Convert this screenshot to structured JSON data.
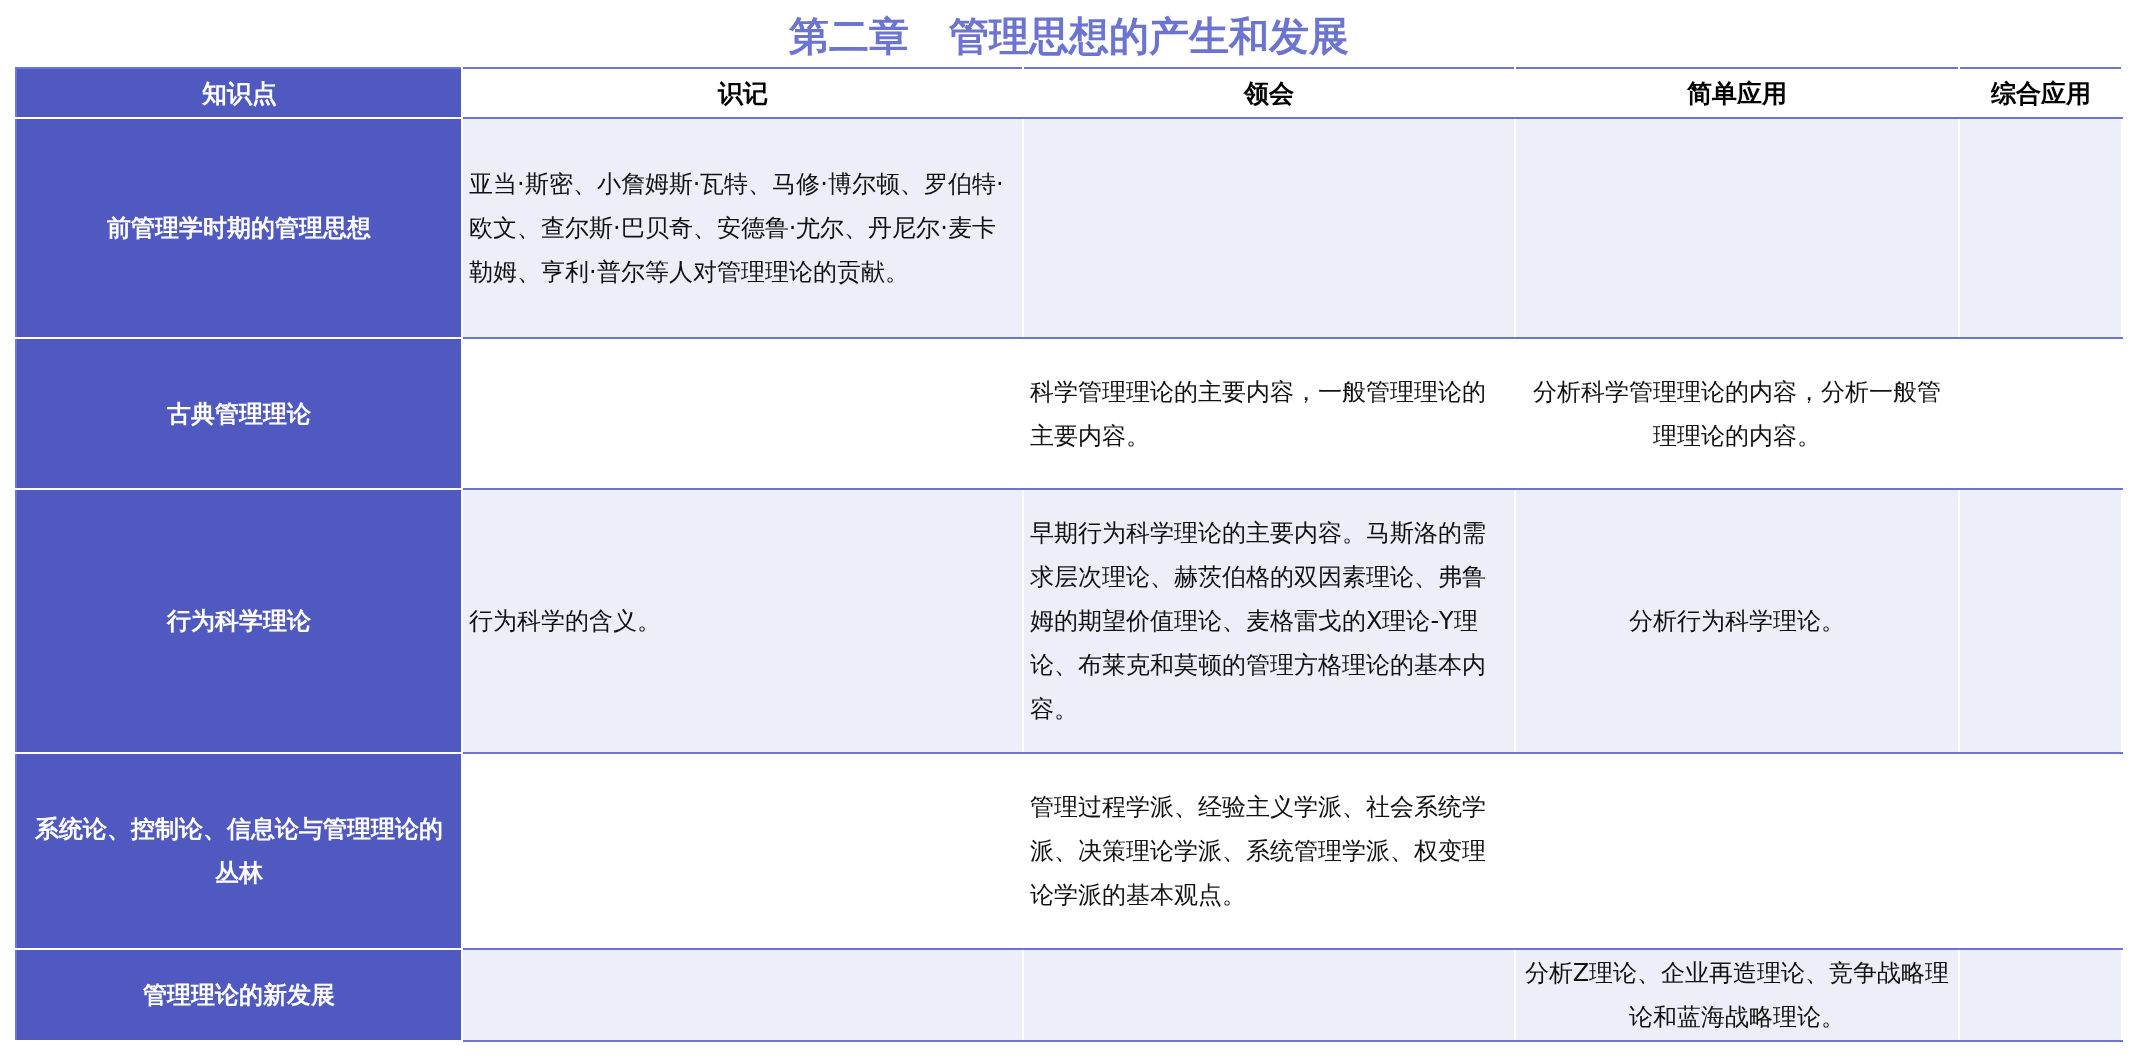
{
  "title": "第二章　管理思想的产生和发展",
  "table": {
    "columns": [
      "知识点",
      "识记",
      "领会",
      "简单应用",
      "综合应用"
    ],
    "rows": [
      {
        "cells": [
          "前管理学时期的管理思想",
          "亚当·斯密、小詹姆斯·瓦特、马修·博尔顿、罗伯特·欧文、查尔斯·巴贝奇、安德鲁·尤尔、丹尼尔·麦卡勒姆、亨利·普尔等人对管理理论的贡献。",
          "",
          "",
          ""
        ]
      },
      {
        "cells": [
          "古典管理理论",
          "",
          "科学管理理论的主要内容，一般管理理论的主要内容。",
          "分析科学管理理论的内容，分析一般管理理论的内容。",
          ""
        ]
      },
      {
        "cells": [
          "行为科学理论",
          "行为科学的含义。",
          "早期行为科学理论的主要内容。马斯洛的需求层次理论、赫茨伯格的双因素理论、弗鲁姆的期望价值理论、麦格雷戈的X理论-Y理论、布莱克和莫顿的管理方格理论的基本内容。",
          "分析行为科学理论。",
          ""
        ]
      },
      {
        "cells": [
          "系统论、控制论、信息论与管理理论的丛林",
          "",
          "管理过程学派、经验主义学派、社会系统学派、决策理论学派、系统管理学派、权变理论学派的基本观点。",
          "",
          ""
        ]
      },
      {
        "cells": [
          "管理理论的新发展",
          "",
          "",
          "分析Z理论、企业再造理论、竞争战略理论和蓝海战略理论。",
          ""
        ]
      }
    ]
  }
}
